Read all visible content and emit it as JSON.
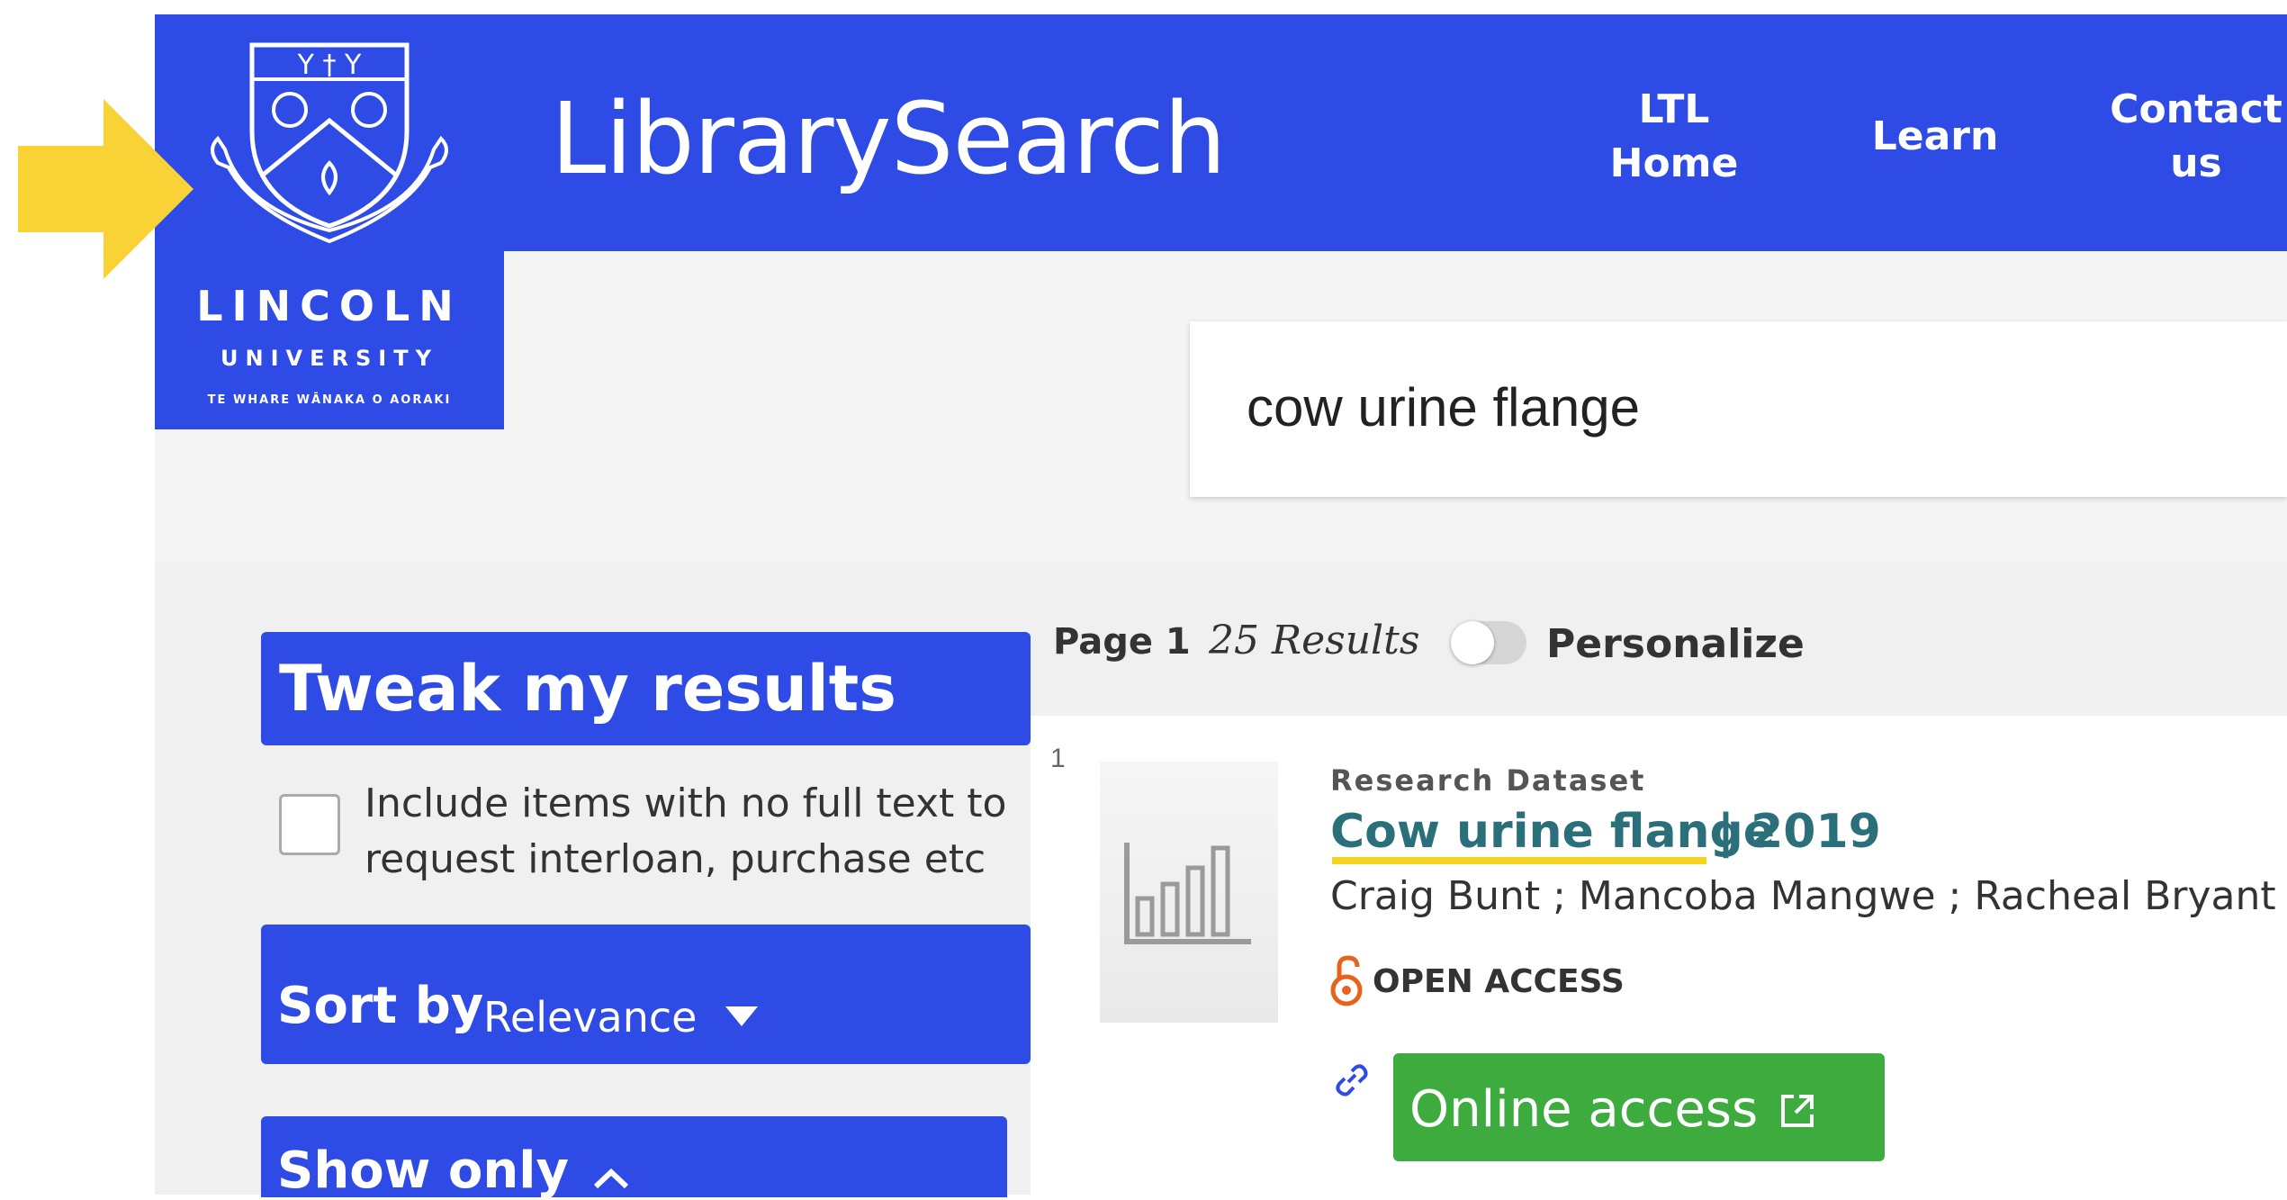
{
  "header": {
    "brand": "LibrarySearch",
    "logo": {
      "name": "LINCOLN",
      "sub": "UNIVERSITY",
      "motto": "TE WHARE WĀNAKA O AORAKI"
    },
    "nav": [
      {
        "label_line1": "LTL",
        "label_line2": "Home"
      },
      {
        "label": "Learn"
      },
      {
        "label_line1": "Contact",
        "label_line2": "us"
      }
    ],
    "brand_color": "#2e4be6"
  },
  "search": {
    "query": "cow urine flange"
  },
  "sidebar": {
    "tweak_title": "Tweak my results",
    "interloan_label": "Include items with no full text to request interloan, purchase etc",
    "sort_label": "Sort by",
    "sort_value": "Relevance",
    "show_only_label": "Show only"
  },
  "results": {
    "page_label": "Page 1",
    "count_label": "25 Results",
    "personalize_label": "Personalize",
    "items": [
      {
        "index": "1",
        "type": "Research Dataset",
        "title": "Cow urine flange",
        "year": "| 2019",
        "authors": "Craig Bunt ; Mancoba Mangwe ; Racheal Bryant ; Mat",
        "access": "OPEN ACCESS",
        "online_label": "Online access"
      }
    ]
  },
  "colors": {
    "accent": "#2e4be6",
    "online_button": "#3dab3d",
    "title": "#2a6f7a",
    "highlight": "#f5d420",
    "arrow": "#f9d235",
    "open_access": "#e8621c"
  },
  "icons": {
    "arrow": "arrow-right-icon",
    "logo": "lincoln-crest-icon",
    "thumbnail": "bar-chart-icon",
    "open_access": "open-lock-icon",
    "link": "link-icon",
    "external": "external-link-icon",
    "dropdown": "caret-down-icon",
    "chevron": "chevron-up-icon"
  }
}
